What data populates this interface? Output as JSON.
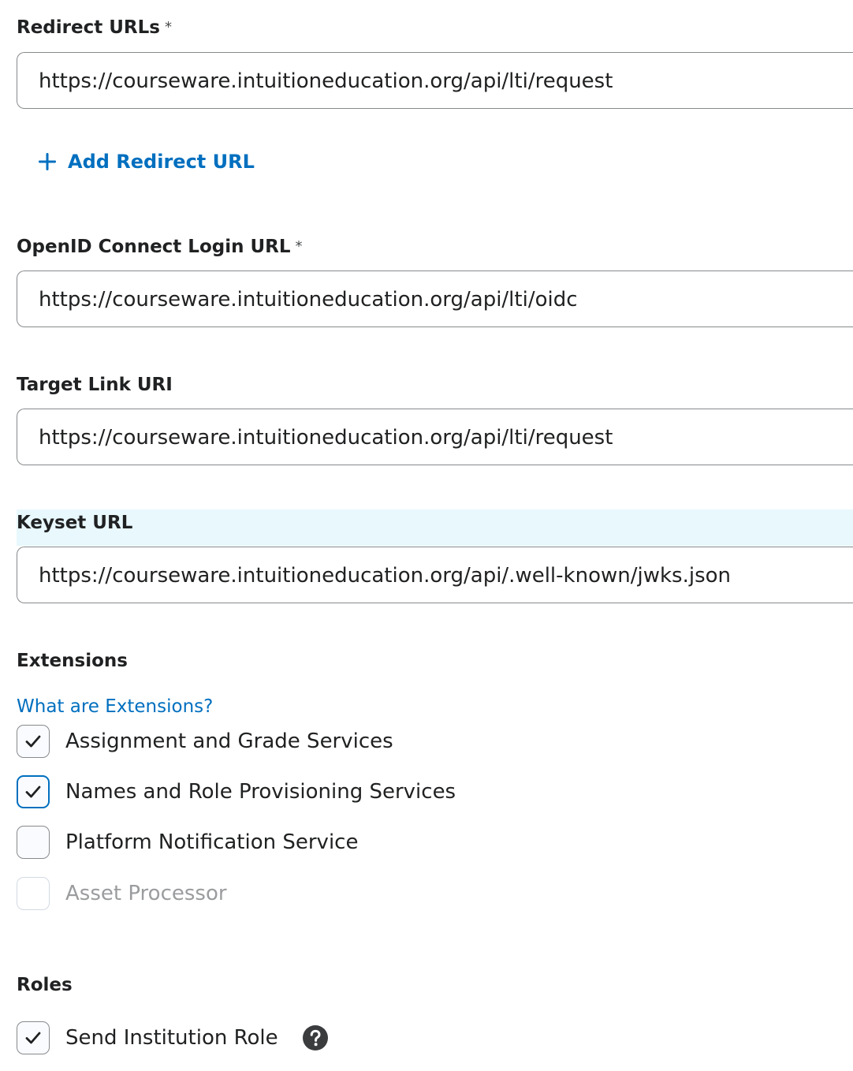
{
  "redirect_urls": {
    "label": "Redirect URLs",
    "required_mark": "*",
    "value": "https://courseware.intuitioneducation.org/api/lti/request",
    "add_label": "Add Redirect URL"
  },
  "openid_login_url": {
    "label": "OpenID Connect Login URL",
    "required_mark": "*",
    "value": "https://courseware.intuitioneducation.org/api/lti/oidc"
  },
  "target_link_uri": {
    "label": "Target Link URI",
    "value": "https://courseware.intuitioneducation.org/api/lti/request"
  },
  "keyset_url": {
    "label": "Keyset URL",
    "value": "https://courseware.intuitioneducation.org/api/.well-known/jwks.json"
  },
  "extensions": {
    "heading": "Extensions",
    "help_link": "What are Extensions?",
    "options": [
      {
        "label": "Assignment and Grade Services",
        "checked": true,
        "disabled": false
      },
      {
        "label": "Names and Role Provisioning Services",
        "checked": true,
        "disabled": false
      },
      {
        "label": "Platform Notification Service",
        "checked": false,
        "disabled": false
      },
      {
        "label": "Asset Processor",
        "checked": false,
        "disabled": true
      }
    ]
  },
  "roles": {
    "heading": "Roles",
    "send_institution_role": {
      "label": "Send Institution Role",
      "checked": true
    }
  },
  "colors": {
    "link": "#006fbf",
    "focus": "#006fbf",
    "highlight": "#e8f8fd",
    "text": "#202122"
  }
}
